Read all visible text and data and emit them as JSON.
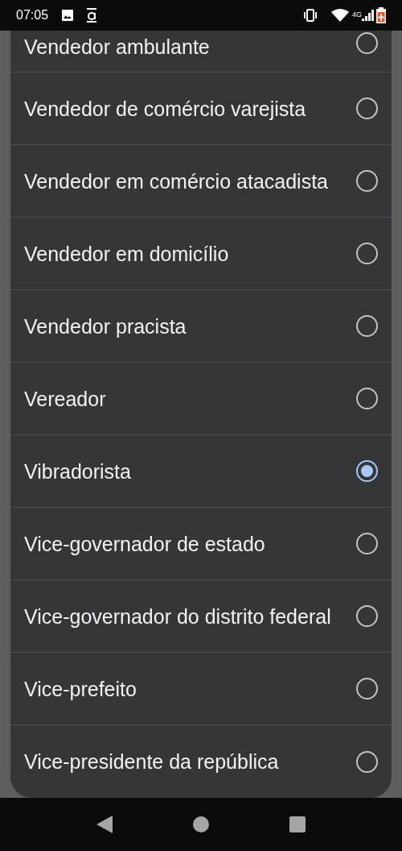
{
  "status_bar": {
    "time": "07:05",
    "network": "4G"
  },
  "options": [
    {
      "label": "Vendedor ambulante",
      "selected": false
    },
    {
      "label": "Vendedor de comércio varejista",
      "selected": false
    },
    {
      "label": "Vendedor em comércio atacadista",
      "selected": false
    },
    {
      "label": "Vendedor em domicílio",
      "selected": false
    },
    {
      "label": "Vendedor pracista",
      "selected": false
    },
    {
      "label": "Vereador",
      "selected": false
    },
    {
      "label": "Vibradorista",
      "selected": true
    },
    {
      "label": "Vice-governador de estado",
      "selected": false
    },
    {
      "label": "Vice-governador do distrito federal",
      "selected": false
    },
    {
      "label": "Vice-prefeito",
      "selected": false
    },
    {
      "label": "Vice-presidente da república",
      "selected": false
    }
  ]
}
